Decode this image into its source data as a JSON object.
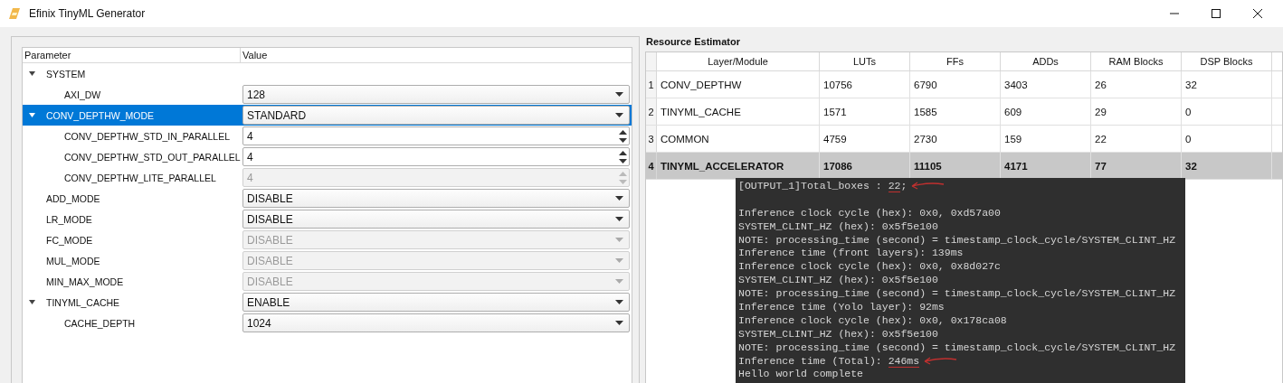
{
  "window": {
    "title": "Efinix TinyML Generator"
  },
  "parameters": {
    "columns": [
      "Parameter",
      "Value"
    ],
    "items": [
      {
        "name": "SYSTEM",
        "expanded": true,
        "selected": false,
        "children": [
          {
            "name": "AXI_DW",
            "kind": "combo",
            "value": "128",
            "disabled": false,
            "selected": false
          }
        ]
      },
      {
        "name": "CONV_DEPTHW_MODE",
        "kind": "combo",
        "value": "STANDARD",
        "disabled": false,
        "expanded": true,
        "selected": true,
        "children": [
          {
            "name": "CONV_DEPTHW_STD_IN_PARALLEL",
            "kind": "spin",
            "value": "4",
            "disabled": false,
            "selected": false
          },
          {
            "name": "CONV_DEPTHW_STD_OUT_PARALLEL",
            "kind": "spin",
            "value": "4",
            "disabled": false,
            "selected": false
          },
          {
            "name": "CONV_DEPTHW_LITE_PARALLEL",
            "kind": "spin",
            "value": "4",
            "disabled": true,
            "selected": false
          }
        ]
      },
      {
        "name": "ADD_MODE",
        "kind": "combo",
        "value": "DISABLE",
        "disabled": false,
        "selected": false
      },
      {
        "name": "LR_MODE",
        "kind": "combo",
        "value": "DISABLE",
        "disabled": false,
        "selected": false
      },
      {
        "name": "FC_MODE",
        "kind": "combo",
        "value": "DISABLE",
        "disabled": true,
        "selected": false
      },
      {
        "name": "MUL_MODE",
        "kind": "combo",
        "value": "DISABLE",
        "disabled": true,
        "selected": false
      },
      {
        "name": "MIN_MAX_MODE",
        "kind": "combo",
        "value": "DISABLE",
        "disabled": true,
        "selected": false
      },
      {
        "name": "TINYML_CACHE",
        "kind": "combo",
        "value": "ENABLE",
        "disabled": false,
        "expanded": true,
        "selected": false,
        "children": [
          {
            "name": "CACHE_DEPTH",
            "kind": "combo",
            "value": "1024",
            "disabled": false,
            "selected": false
          }
        ]
      }
    ]
  },
  "resource_estimator": {
    "title": "Resource Estimator",
    "columns": [
      "Layer/Module",
      "LUTs",
      "FFs",
      "ADDs",
      "RAM Blocks",
      "DSP Blocks"
    ],
    "rows": [
      {
        "index": "1",
        "cells": [
          "CONV_DEPTHW",
          "10756",
          "6790",
          "3403",
          "26",
          "32"
        ],
        "total": false
      },
      {
        "index": "2",
        "cells": [
          "TINYML_CACHE",
          "1571",
          "1585",
          "609",
          "29",
          "0"
        ],
        "total": false
      },
      {
        "index": "3",
        "cells": [
          "COMMON",
          "4759",
          "2730",
          "159",
          "22",
          "0"
        ],
        "total": false
      },
      {
        "index": "4",
        "cells": [
          "TINYML_ACCELERATOR",
          "17086",
          "11105",
          "4171",
          "77",
          "32"
        ],
        "total": true
      }
    ]
  },
  "console": {
    "groups": [
      {
        "lines": [
          {
            "parts": [
              {
                "text": "[OUTPUT_1]Total_boxes : ",
                "underlined": false
              },
              {
                "text": "22",
                "underlined": true
              },
              {
                "text": ";",
                "underlined": false
              }
            ],
            "arrow": true
          }
        ]
      },
      {
        "lines": [
          {
            "parts": [
              {
                "text": "Inference clock cycle (hex): 0x0, 0xd57a00",
                "underlined": false
              }
            ],
            "arrow": false
          },
          {
            "parts": [
              {
                "text": "SYSTEM_CLINT_HZ (hex): 0x5f5e100",
                "underlined": false
              }
            ],
            "arrow": false
          },
          {
            "parts": [
              {
                "text": "NOTE: processing_time (second) = timestamp_clock_cycle/SYSTEM_CLINT_HZ",
                "underlined": false
              }
            ],
            "arrow": false
          },
          {
            "parts": [
              {
                "text": "Inference time (front layers): 139ms",
                "underlined": false
              }
            ],
            "arrow": false
          },
          {
            "parts": [
              {
                "text": "Inference clock cycle (hex): 0x0, 0x8d027c",
                "underlined": false
              }
            ],
            "arrow": false
          },
          {
            "parts": [
              {
                "text": "SYSTEM_CLINT_HZ (hex): 0x5f5e100",
                "underlined": false
              }
            ],
            "arrow": false
          },
          {
            "parts": [
              {
                "text": "NOTE: processing_time (second) = timestamp_clock_cycle/SYSTEM_CLINT_HZ",
                "underlined": false
              }
            ],
            "arrow": false
          },
          {
            "parts": [
              {
                "text": "Inference time (Yolo layer): 92ms",
                "underlined": false
              }
            ],
            "arrow": false
          },
          {
            "parts": [
              {
                "text": "Inference clock cycle (hex): 0x0, 0x178ca08",
                "underlined": false
              }
            ],
            "arrow": false
          },
          {
            "parts": [
              {
                "text": "SYSTEM_CLINT_HZ (hex): 0x5f5e100",
                "underlined": false
              }
            ],
            "arrow": false
          },
          {
            "parts": [
              {
                "text": "NOTE: processing_time (second) = timestamp_clock_cycle/SYSTEM_CLINT_HZ",
                "underlined": false
              }
            ],
            "arrow": false
          },
          {
            "parts": [
              {
                "text": "Inference time (Total): ",
                "underlined": false
              },
              {
                "text": "246ms",
                "underlined": true
              }
            ],
            "arrow": true
          },
          {
            "parts": [
              {
                "text": "Hello world complete",
                "underlined": false
              }
            ],
            "arrow": false
          }
        ]
      }
    ]
  }
}
